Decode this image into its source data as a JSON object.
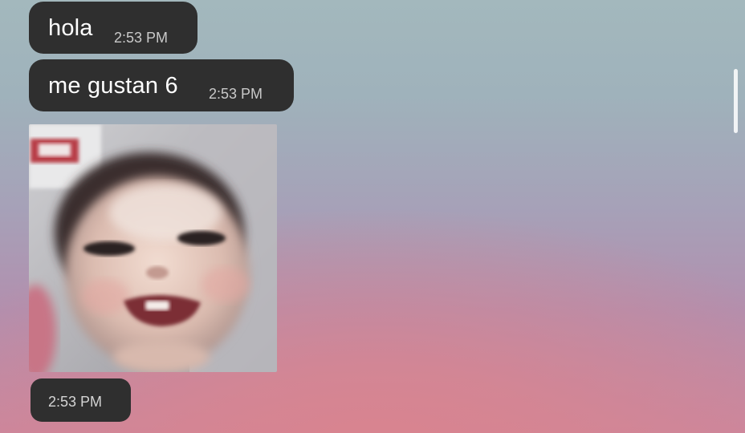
{
  "messages": [
    {
      "text": "hola",
      "time": "2:53 PM"
    },
    {
      "text": "me gustan 6",
      "time": "2:53 PM"
    },
    {
      "type": "photo",
      "time": "2:53 PM"
    }
  ],
  "colors": {
    "bubble": "#2f2f2f",
    "bubble_text": "#ffffff",
    "timestamp": "#c9c9c9"
  }
}
